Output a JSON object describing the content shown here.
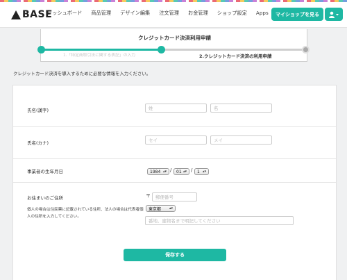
{
  "app": {
    "logo_text": "BASE"
  },
  "nav": {
    "items": [
      "ダッシュボード",
      "商品管理",
      "デザイン編集",
      "注文管理",
      "お金管理",
      "ショップ設定",
      "Apps"
    ],
    "myshop_label": "マイショップを見る"
  },
  "progress": {
    "title": "クレジットカード決済利用申請",
    "step1": "1.「特定商取引法に関する表記」の入力",
    "step2": "2.クレジットカード決済の利用申請",
    "completed_fraction": 0.45
  },
  "intro": "クレジットカード決済を導入するために必要な情報を入力ください。",
  "form": {
    "name_kanji": {
      "label": "氏名(漢字)",
      "last_placeholder": "姓",
      "first_placeholder": "名"
    },
    "name_kana": {
      "label": "氏名(カナ)",
      "last_placeholder": "セイ",
      "first_placeholder": "メイ"
    },
    "birthdate": {
      "label": "事業者の生年月日",
      "year": "1984",
      "month": "01",
      "day": "1",
      "sep": "/"
    },
    "address": {
      "label": "お住まいのご住所",
      "note": "個人の場合は住民票に記載されている住所、法人の場合は代表者個人の住所を入力してください。",
      "postal_mark": "〒",
      "postal_placeholder": "郵便番号",
      "prefecture": "東京都",
      "street_placeholder": "番地、建物名まで明記してください"
    },
    "save_label": "保存する"
  },
  "colors": {
    "accent": "#1eb8a3"
  }
}
